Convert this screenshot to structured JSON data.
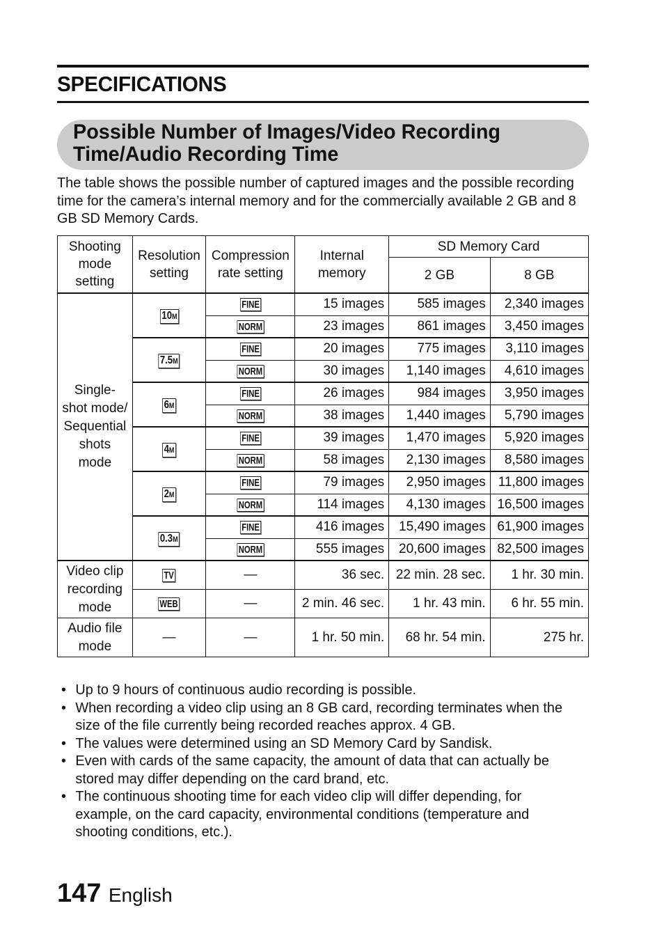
{
  "header": {
    "section_title": "SPECIFICATIONS",
    "heading_line1": "Possible Number of Images/Video Recording",
    "heading_line2": "Time/Audio Recording Time",
    "intro": "The table shows the possible number of captured images and the possible recording time for the camera’s internal memory and for the commercially available 2 GB and 8 GB SD Memory Cards."
  },
  "table": {
    "headers": {
      "shooting_mode": "Shooting mode setting",
      "resolution": "Resolution setting",
      "compression": "Compression rate setting",
      "internal": "Internal memory",
      "sd_card": "SD Memory Card",
      "sd_2gb": "2 GB",
      "sd_8gb": "8 GB"
    },
    "single_shot_label": "Single-shot mode/ Sequential shots mode",
    "resolutions": [
      {
        "icon_main": "10",
        "icon_unit": "M",
        "rows": [
          {
            "quality": "FINE",
            "internal": "15 images",
            "gb2": "585 images",
            "gb8": "2,340 images"
          },
          {
            "quality": "NORM",
            "internal": "23 images",
            "gb2": "861 images",
            "gb8": "3,450 images"
          }
        ]
      },
      {
        "icon_main": "7.5",
        "icon_unit": "M",
        "rows": [
          {
            "quality": "FINE",
            "internal": "20 images",
            "gb2": "775 images",
            "gb8": "3,110 images"
          },
          {
            "quality": "NORM",
            "internal": "30 images",
            "gb2": "1,140 images",
            "gb8": "4,610 images"
          }
        ]
      },
      {
        "icon_main": "6",
        "icon_unit": "M",
        "rows": [
          {
            "quality": "FINE",
            "internal": "26 images",
            "gb2": "984 images",
            "gb8": "3,950 images"
          },
          {
            "quality": "NORM",
            "internal": "38 images",
            "gb2": "1,440 images",
            "gb8": "5,790 images"
          }
        ]
      },
      {
        "icon_main": "4",
        "icon_unit": "M",
        "rows": [
          {
            "quality": "FINE",
            "internal": "39 images",
            "gb2": "1,470 images",
            "gb8": "5,920 images"
          },
          {
            "quality": "NORM",
            "internal": "58 images",
            "gb2": "2,130 images",
            "gb8": "8,580 images"
          }
        ]
      },
      {
        "icon_main": "2",
        "icon_unit": "M",
        "rows": [
          {
            "quality": "FINE",
            "internal": "79 images",
            "gb2": "2,950 images",
            "gb8": "11,800 images"
          },
          {
            "quality": "NORM",
            "internal": "114 images",
            "gb2": "4,130 images",
            "gb8": "16,500 images"
          }
        ]
      },
      {
        "icon_main": "0.3",
        "icon_unit": "M",
        "rows": [
          {
            "quality": "FINE",
            "internal": "416 images",
            "gb2": "15,490 images",
            "gb8": "61,900 images"
          },
          {
            "quality": "NORM",
            "internal": "555 images",
            "gb2": "20,600 images",
            "gb8": "82,500 images"
          }
        ]
      }
    ],
    "video": {
      "label": "Video clip recording mode",
      "rows": [
        {
          "icon": "TV",
          "compression": "—",
          "internal": "36 sec.",
          "gb2": "22 min. 28 sec.",
          "gb8": "1 hr. 30 min."
        },
        {
          "icon": "WEB",
          "compression": "—",
          "internal": "2 min. 46 sec.",
          "gb2": "1 hr. 43 min.",
          "gb8": "6 hr. 55 min."
        }
      ]
    },
    "audio": {
      "label": "Audio file mode",
      "resolution": "—",
      "compression": "—",
      "internal": "1 hr. 50 min.",
      "gb2": "68 hr. 54 min.",
      "gb8": "275 hr."
    }
  },
  "notes": {
    "bullet": "•",
    "items": [
      "Up to 9 hours of continuous audio recording is possible.",
      "When recording a video clip using an 8 GB card, recording terminates when the size of the file currently being recorded reaches approx. 4 GB.",
      "The values were determined using an SD Memory Card by Sandisk.",
      "Even with cards of the same capacity, the amount of data that can actually be stored may differ depending on the card brand, etc.",
      "The continuous shooting time for each video clip will differ depending, for example, on the card capacity, environmental conditions (temperature and shooting conditions, etc.)."
    ]
  },
  "footer": {
    "page_number": "147",
    "language": "English"
  }
}
